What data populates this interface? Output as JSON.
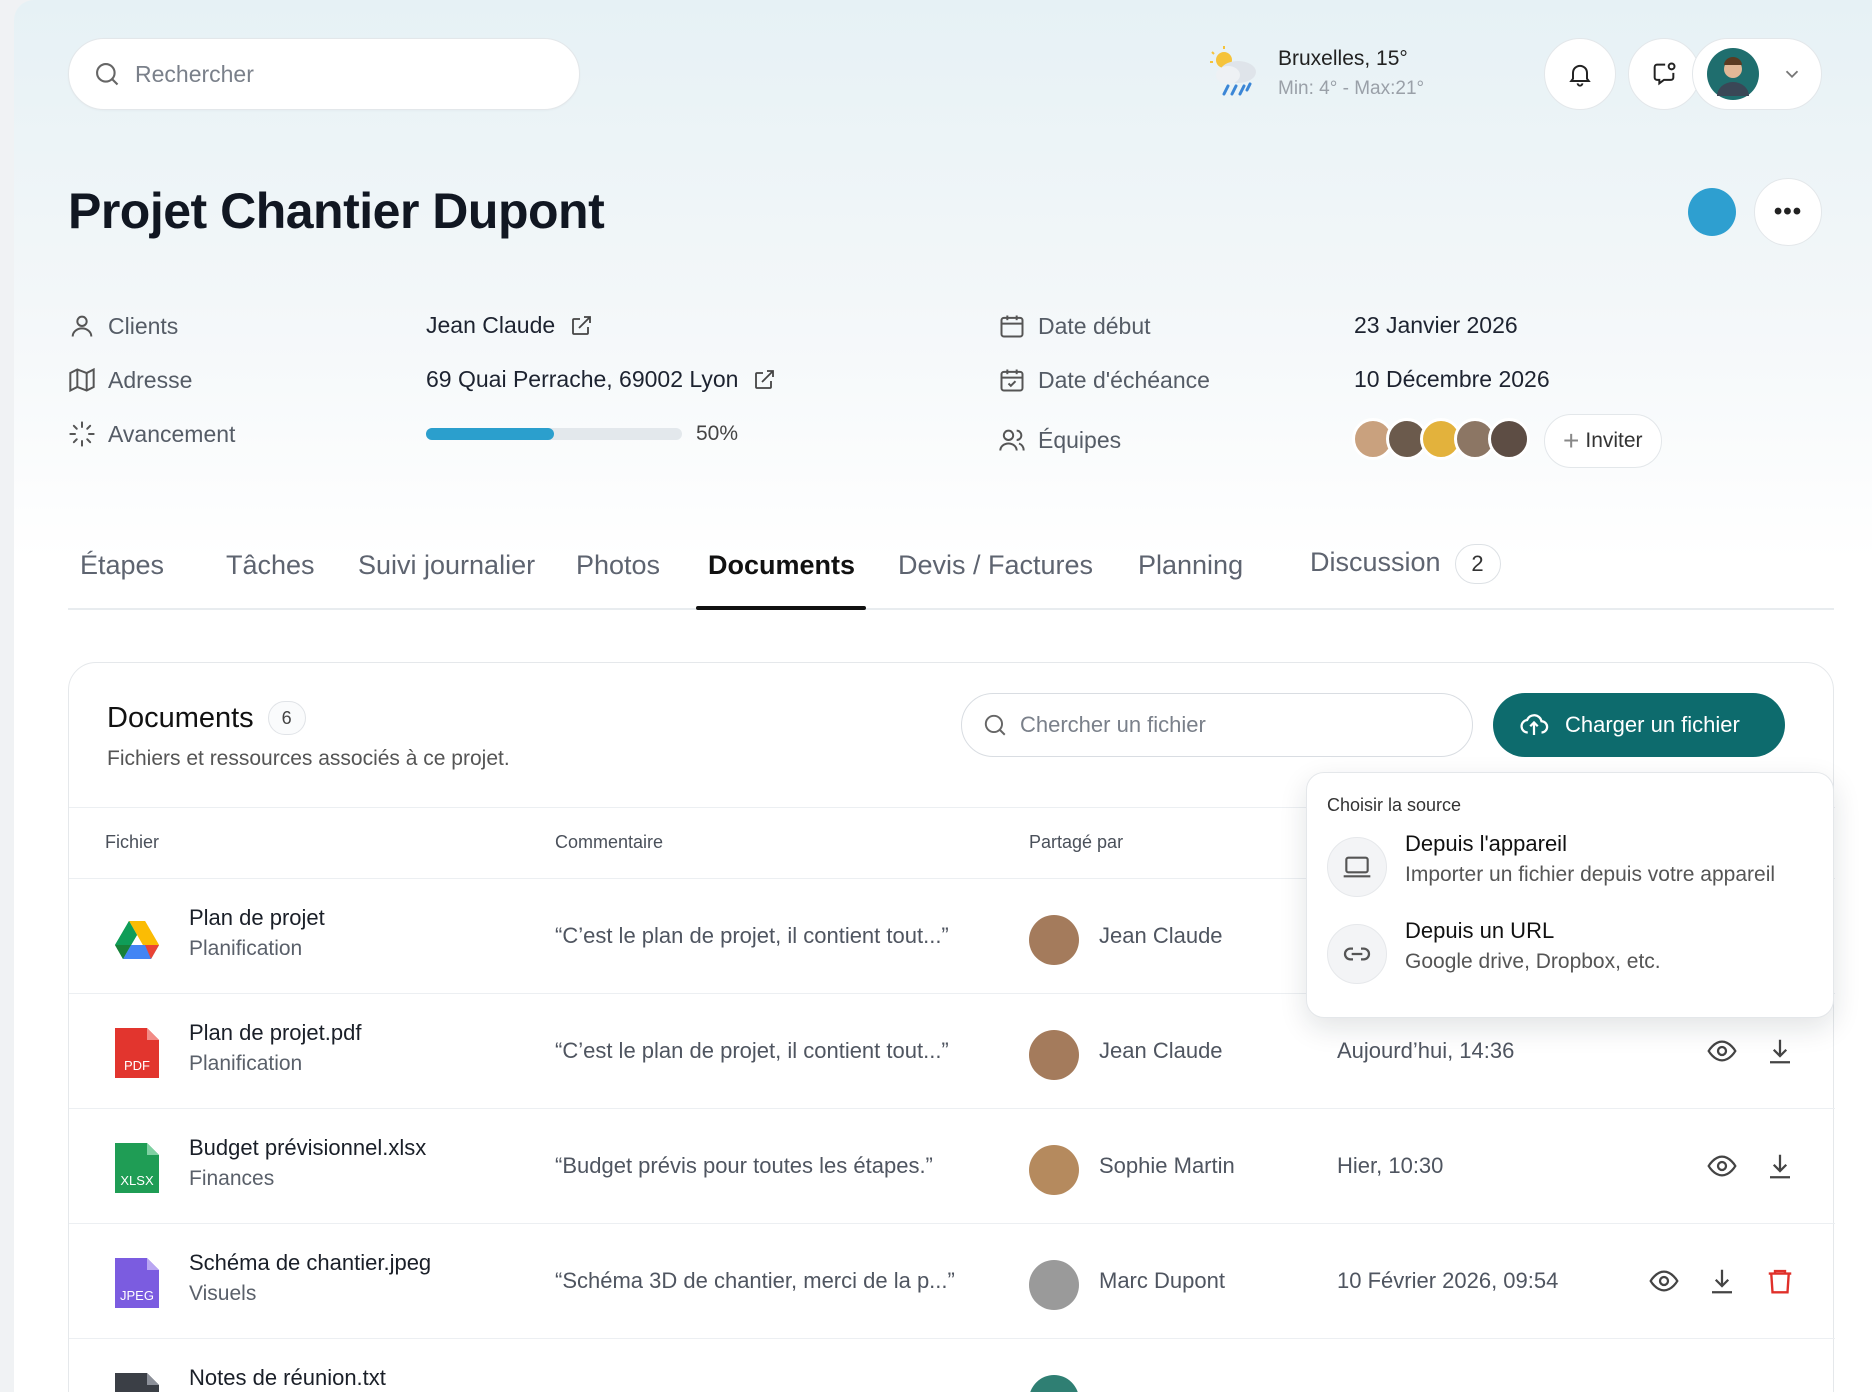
{
  "header": {
    "search_placeholder": "Rechercher",
    "weather": {
      "city": "Bruxelles, 15°",
      "minmax": "Min: 4° - Max:21°",
      "icon": "rain-sun-icon"
    }
  },
  "project": {
    "title": "Projet Chantier Dupont",
    "status_color": "#2e9fd0",
    "info": {
      "clients_label": "Clients",
      "clients_value": "Jean Claude",
      "adresse_label": "Adresse",
      "adresse_value": "69 Quai Perrache, 69002 Lyon",
      "avancement_label": "Avancement",
      "avancement_value": 0.5,
      "avancement_text": "50%",
      "date_debut_label": "Date début",
      "date_debut_value": "23 Janvier 2026",
      "echeance_label": "Date d'échéance",
      "echeance_value": "10 Décembre 2026",
      "equipes_label": "Équipes",
      "invite_label": "Inviter"
    }
  },
  "tabs": [
    {
      "label": "Étapes"
    },
    {
      "label": "Tâches"
    },
    {
      "label": "Suivi journalier"
    },
    {
      "label": "Photos"
    },
    {
      "label": "Documents",
      "active": true
    },
    {
      "label": "Devis / Factures"
    },
    {
      "label": "Planning"
    },
    {
      "label": "Discussion",
      "badge": "2"
    }
  ],
  "documents": {
    "title": "Documents",
    "count": "6",
    "subtitle": "Fichiers et ressources associés à ce projet.",
    "search_placeholder": "Chercher un fichier",
    "upload_label": "Charger un fichier",
    "columns": {
      "file": "Fichier",
      "comment": "Commentaire",
      "shared_by": "Partagé par"
    },
    "rows": [
      {
        "name": "Plan de projet",
        "category": "Planification",
        "comment": "“C’est le plan de projet, il contient tout...”",
        "shared_by": "Jean Claude",
        "date": "",
        "type": "gdrive"
      },
      {
        "name": "Plan de projet.pdf",
        "category": "Planification",
        "comment": "“C’est le plan de projet, il contient tout...”",
        "shared_by": "Jean Claude",
        "date": "Aujourd’hui, 14:36",
        "type": "PDF"
      },
      {
        "name": "Budget prévisionnel.xlsx",
        "category": "Finances",
        "comment": "“Budget prévis pour toutes les étapes.”",
        "shared_by": "Sophie Martin",
        "date": "Hier, 10:30",
        "type": "XLSX"
      },
      {
        "name": "Schéma de chantier.jpeg",
        "category": "Visuels",
        "comment": "“Schéma 3D de chantier, merci de la p...”",
        "shared_by": "Marc Dupont",
        "date": "10 Février 2026, 09:54",
        "type": "JPEG"
      },
      {
        "name": "Notes de réunion.txt",
        "category": "",
        "comment": "",
        "shared_by": "",
        "date": "",
        "type": "TXT"
      }
    ]
  },
  "source_menu": {
    "title": "Choisir la source",
    "items": [
      {
        "title": "Depuis l'appareil",
        "desc": "Importer un fichier depuis votre appareil"
      },
      {
        "title": "Depuis un URL",
        "desc": "Google drive, Dropbox, etc."
      }
    ]
  }
}
